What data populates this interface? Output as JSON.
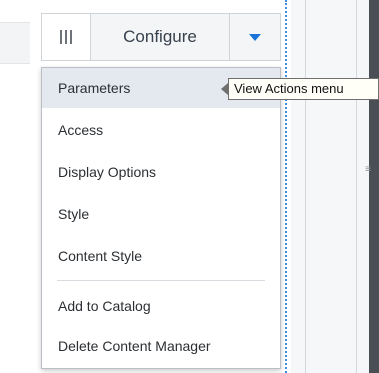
{
  "toolbar": {
    "drag_icon": "drag-handle-icon",
    "configure_label": "Configure",
    "dropdown_icon": "caret-down-icon",
    "accent_color": "#1a73d9"
  },
  "menu": {
    "items": [
      {
        "label": "Parameters"
      },
      {
        "label": "Access"
      },
      {
        "label": "Display Options"
      },
      {
        "label": "Style"
      },
      {
        "label": "Content Style"
      },
      {
        "label": "Add to Catalog"
      },
      {
        "label": "Delete Content Manager"
      }
    ],
    "hovered_item": "Parameters"
  },
  "tooltip": {
    "text": "View Actions menu"
  },
  "splitter": {
    "icon": "splitter-grip-icon",
    "glyph": "≡"
  }
}
